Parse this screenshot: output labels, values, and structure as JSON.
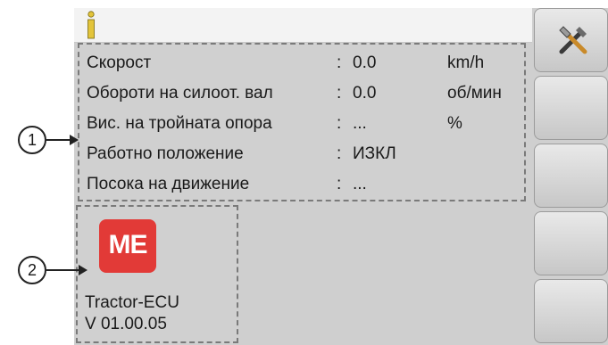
{
  "info_rows": [
    {
      "label": "Скорост",
      "sep": ":",
      "value": "0.0",
      "unit": "km/h"
    },
    {
      "label": "Обороти на силоот. вал",
      "sep": ":",
      "value": "0.0",
      "unit": "об/мин"
    },
    {
      "label": "Вис. на тройната опора",
      "sep": ":",
      "value": "...",
      "unit": "%"
    },
    {
      "label": "Работно положение",
      "sep": ":",
      "value": "ИЗКЛ",
      "unit": ""
    },
    {
      "label": "Посока на движение",
      "sep": ":",
      "value": "...",
      "unit": ""
    }
  ],
  "ecu": {
    "logo_text": "ME",
    "name": "Tractor-ECU",
    "version": "V 01.00.05"
  },
  "callouts": [
    "1",
    "2"
  ],
  "softkeys": [
    {
      "icon": "tools-icon"
    },
    {
      "icon": ""
    },
    {
      "icon": ""
    },
    {
      "icon": ""
    },
    {
      "icon": ""
    }
  ],
  "colors": {
    "logo_red": "#e23a37",
    "info_icon_yellow": "#e3c43a"
  }
}
